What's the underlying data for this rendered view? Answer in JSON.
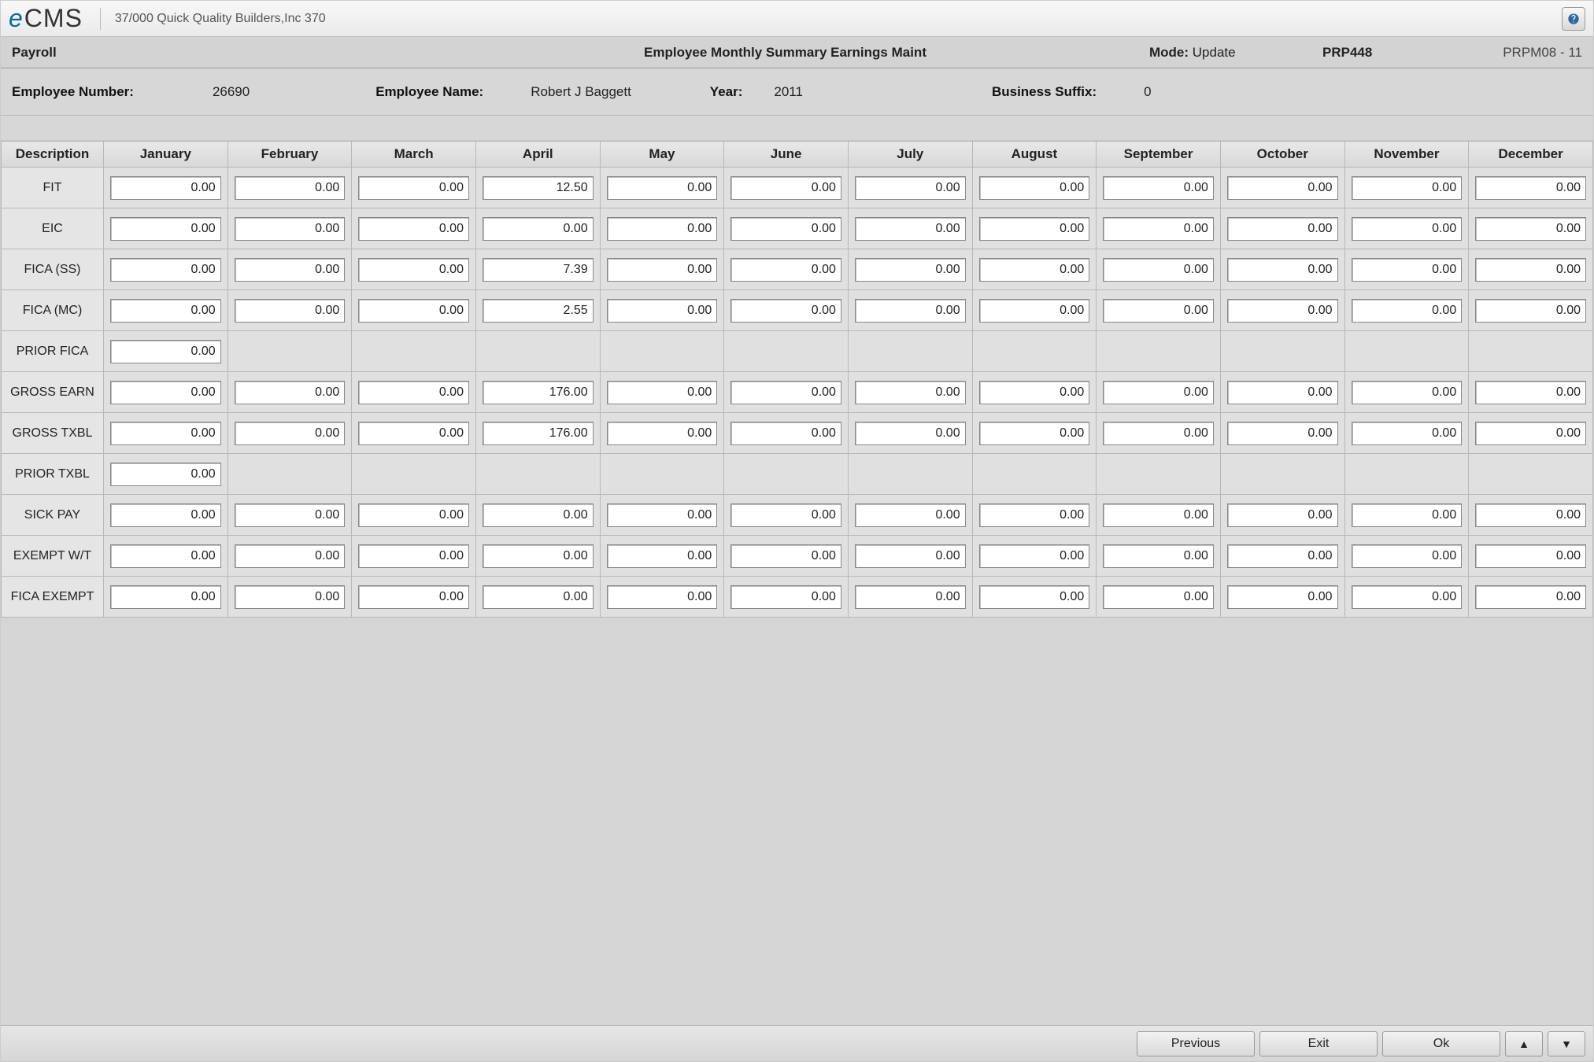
{
  "brand": {
    "e": "e",
    "cms": "CMS",
    "company": "37/000   Quick Quality Builders,Inc 370"
  },
  "help_tooltip": "Help",
  "titlebar": {
    "module": "Payroll",
    "title": "Employee Monthly Summary Earnings Maint",
    "mode_label": "Mode:",
    "mode_value": "Update",
    "program": "PRP448",
    "screen": "PRPM08 - 11"
  },
  "info": {
    "emp_num_lbl": "Employee Number:",
    "emp_num_val": "26690",
    "emp_name_lbl": "Employee Name:",
    "emp_name_val": "Robert J Baggett",
    "year_lbl": "Year:",
    "year_val": "2011",
    "suffix_lbl": "Business Suffix:",
    "suffix_val": "0"
  },
  "columns": [
    "Description",
    "January",
    "February",
    "March",
    "April",
    "May",
    "June",
    "July",
    "August",
    "September",
    "October",
    "November",
    "December"
  ],
  "rows": [
    {
      "label": "FIT",
      "vals": [
        "0.00",
        "0.00",
        "0.00",
        "12.50",
        "0.00",
        "0.00",
        "0.00",
        "0.00",
        "0.00",
        "0.00",
        "0.00",
        "0.00"
      ]
    },
    {
      "label": "EIC",
      "vals": [
        "0.00",
        "0.00",
        "0.00",
        "0.00",
        "0.00",
        "0.00",
        "0.00",
        "0.00",
        "0.00",
        "0.00",
        "0.00",
        "0.00"
      ]
    },
    {
      "label": "FICA (SS)",
      "vals": [
        "0.00",
        "0.00",
        "0.00",
        "7.39",
        "0.00",
        "0.00",
        "0.00",
        "0.00",
        "0.00",
        "0.00",
        "0.00",
        "0.00"
      ]
    },
    {
      "label": "FICA (MC)",
      "vals": [
        "0.00",
        "0.00",
        "0.00",
        "2.55",
        "0.00",
        "0.00",
        "0.00",
        "0.00",
        "0.00",
        "0.00",
        "0.00",
        "0.00"
      ]
    },
    {
      "label": "PRIOR FICA",
      "vals": [
        "0.00",
        null,
        null,
        null,
        null,
        null,
        null,
        null,
        null,
        null,
        null,
        null
      ]
    },
    {
      "label": "GROSS EARN",
      "vals": [
        "0.00",
        "0.00",
        "0.00",
        "176.00",
        "0.00",
        "0.00",
        "0.00",
        "0.00",
        "0.00",
        "0.00",
        "0.00",
        "0.00"
      ]
    },
    {
      "label": "GROSS TXBL",
      "vals": [
        "0.00",
        "0.00",
        "0.00",
        "176.00",
        "0.00",
        "0.00",
        "0.00",
        "0.00",
        "0.00",
        "0.00",
        "0.00",
        "0.00"
      ]
    },
    {
      "label": "PRIOR TXBL",
      "vals": [
        "0.00",
        null,
        null,
        null,
        null,
        null,
        null,
        null,
        null,
        null,
        null,
        null
      ]
    },
    {
      "label": "SICK PAY",
      "vals": [
        "0.00",
        "0.00",
        "0.00",
        "0.00",
        "0.00",
        "0.00",
        "0.00",
        "0.00",
        "0.00",
        "0.00",
        "0.00",
        "0.00"
      ]
    },
    {
      "label": "EXEMPT W/T",
      "vals": [
        "0.00",
        "0.00",
        "0.00",
        "0.00",
        "0.00",
        "0.00",
        "0.00",
        "0.00",
        "0.00",
        "0.00",
        "0.00",
        "0.00"
      ]
    },
    {
      "label": "FICA EXEMPT",
      "vals": [
        "0.00",
        "0.00",
        "0.00",
        "0.00",
        "0.00",
        "0.00",
        "0.00",
        "0.00",
        "0.00",
        "0.00",
        "0.00",
        "0.00"
      ]
    }
  ],
  "footer": {
    "previous": "Previous",
    "exit": "Exit",
    "ok": "Ok",
    "up": "▲",
    "down": "▼"
  }
}
